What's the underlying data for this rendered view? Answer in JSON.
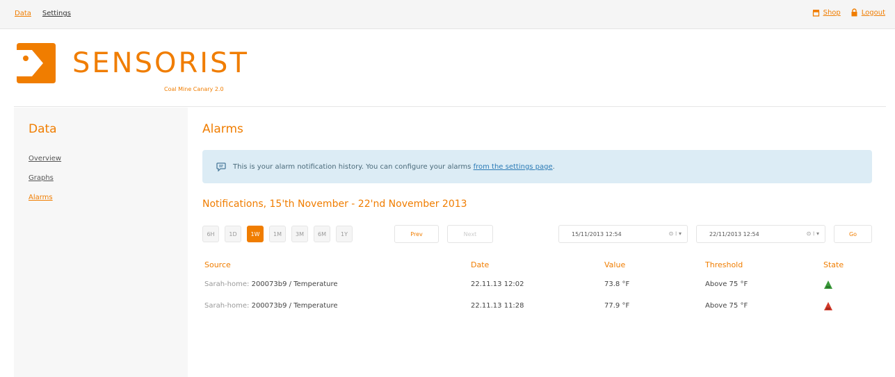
{
  "topbar": {
    "left_links": [
      {
        "label": "Data",
        "active": true
      },
      {
        "label": "Settings",
        "active": false
      }
    ],
    "right_links": [
      {
        "label": "Shop",
        "icon": "shop-icon"
      },
      {
        "label": "Logout",
        "icon": "lock-icon"
      }
    ]
  },
  "header": {
    "brand": "SENSORIST",
    "tagline": "Coal Mine Canary 2.0",
    "logo_icon": "sensorist-logo-icon"
  },
  "sidebar": {
    "title": "Data",
    "items": [
      {
        "label": "Overview",
        "active": false
      },
      {
        "label": "Graphs",
        "active": false
      },
      {
        "label": "Alarms",
        "active": true
      }
    ]
  },
  "main": {
    "title": "Alarms",
    "info": {
      "icon": "chat-bubble-icon",
      "text": "This is your alarm notification history. You can configure your alarms",
      "link_text": "from the settings page",
      "trailing": "."
    },
    "subheading": "Notifications, 15'th November - 22'nd November 2013",
    "ranges": [
      {
        "label": "6H",
        "active": false
      },
      {
        "label": "1D",
        "active": false
      },
      {
        "label": "1W",
        "active": true
      },
      {
        "label": "1M",
        "active": false
      },
      {
        "label": "3M",
        "active": false
      },
      {
        "label": "6M",
        "active": false
      },
      {
        "label": "1Y",
        "active": false
      }
    ],
    "prev_label": "Prev",
    "next_label": "Next",
    "go_label": "Go",
    "from_date": "15/11/2013 12:54",
    "to_date": "22/11/2013 12:54",
    "date_controls": "⊙ ⁞ ▾"
  },
  "table": {
    "columns": [
      "Source",
      "Date",
      "Value",
      "Threshold",
      "State"
    ],
    "rows": [
      {
        "source_prefix": "Sarah-home:",
        "source": "200073b9 / Temperature",
        "date": "22.11.13 12:02",
        "value": "73.8 °F",
        "threshold": "Above 75 °F",
        "state": "ok",
        "state_color": "#3a9a3a"
      },
      {
        "source_prefix": "Sarah-home:",
        "source": "200073b9 / Temperature",
        "date": "22.11.13 11:28",
        "value": "77.9 °F",
        "threshold": "Above 75 °F",
        "state": "alarm",
        "state_color": "#d23a2a"
      }
    ]
  },
  "colors": {
    "accent": "#f07d00",
    "info_bg": "#dcecf5",
    "state_ok": "#3a9a3a",
    "state_alarm": "#d23a2a"
  }
}
